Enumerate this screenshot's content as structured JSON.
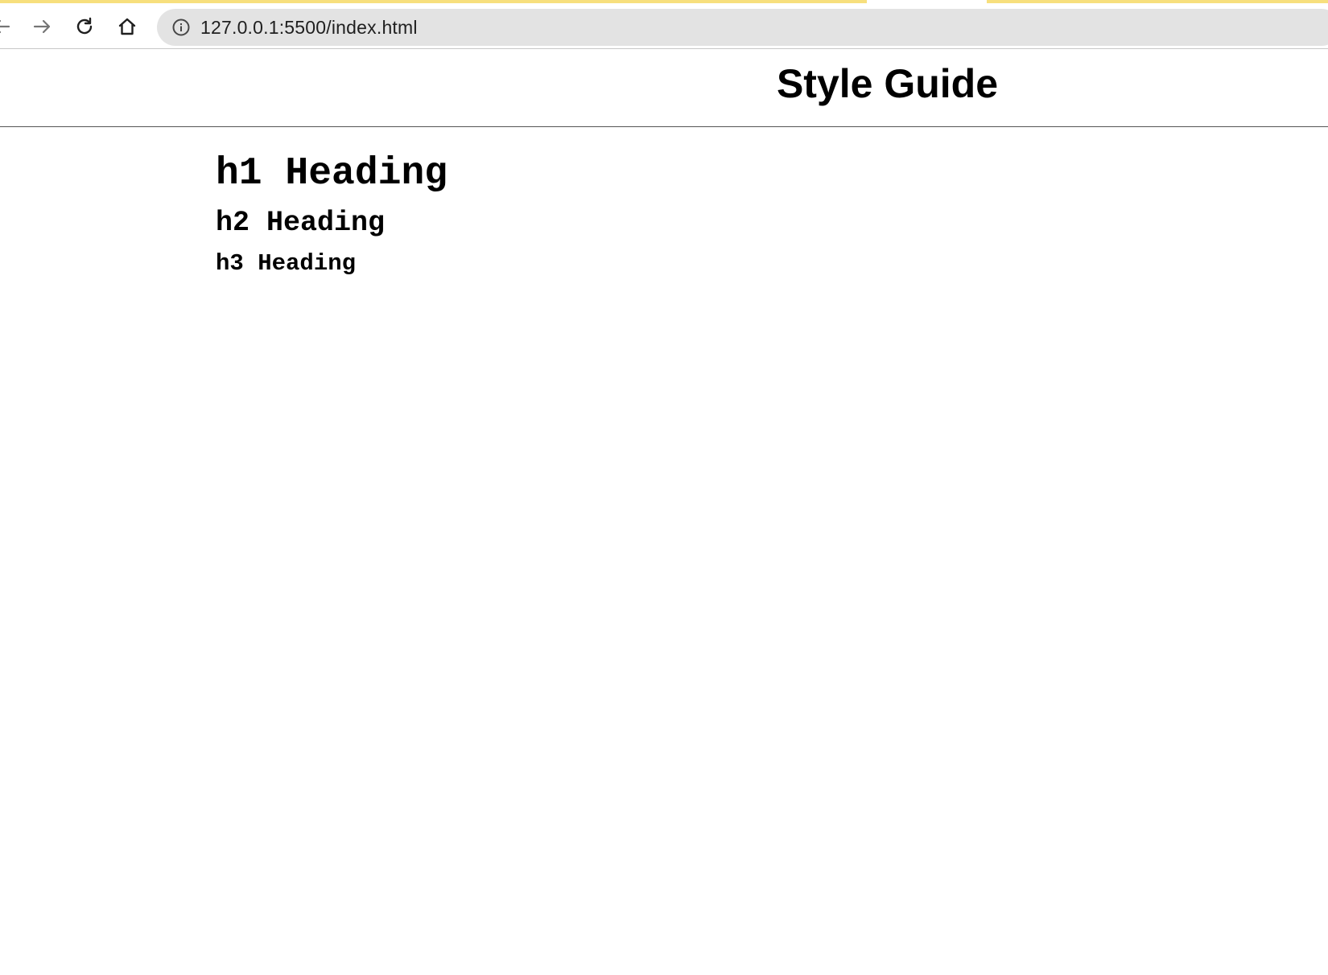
{
  "browser": {
    "url": "127.0.0.1:5500/index.html",
    "icons": {
      "back": "back-arrow-icon",
      "forward": "forward-arrow-icon",
      "reload": "reload-icon",
      "home": "home-icon",
      "site_info": "info-icon"
    },
    "accent_color": "#f7df7d"
  },
  "page": {
    "title": "Style Guide",
    "headings": {
      "h1": "h1 Heading",
      "h2": "h2 Heading",
      "h3": "h3 Heading"
    }
  }
}
